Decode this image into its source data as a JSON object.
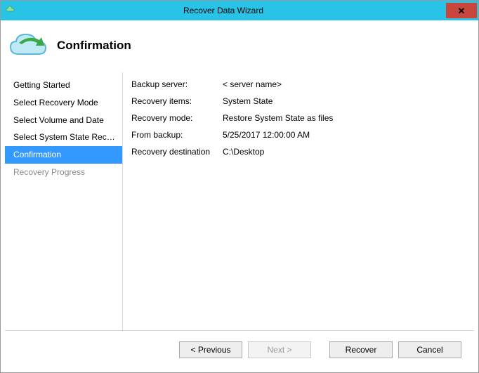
{
  "window": {
    "title": "Recover Data Wizard"
  },
  "header": {
    "title": "Confirmation"
  },
  "sidebar": {
    "items": [
      {
        "label": "Getting Started"
      },
      {
        "label": "Select Recovery Mode"
      },
      {
        "label": "Select Volume and Date"
      },
      {
        "label": "Select System State Reco..."
      },
      {
        "label": "Confirmation"
      },
      {
        "label": "Recovery Progress"
      }
    ]
  },
  "main": {
    "fields": {
      "backup_server_label": "Backup server:",
      "backup_server_value": "< server name>",
      "recovery_items_label": "Recovery items:",
      "recovery_items_value": "System State",
      "recovery_mode_label": "Recovery mode:",
      "recovery_mode_value": "Restore System State as files",
      "from_backup_label": "From backup:",
      "from_backup_value": "5/25/2017 12:00:00 AM",
      "recovery_dest_label": "Recovery destination",
      "recovery_dest_value": "C:\\Desktop"
    }
  },
  "footer": {
    "previous": "< Previous",
    "next": "Next >",
    "recover": "Recover",
    "cancel": "Cancel"
  }
}
